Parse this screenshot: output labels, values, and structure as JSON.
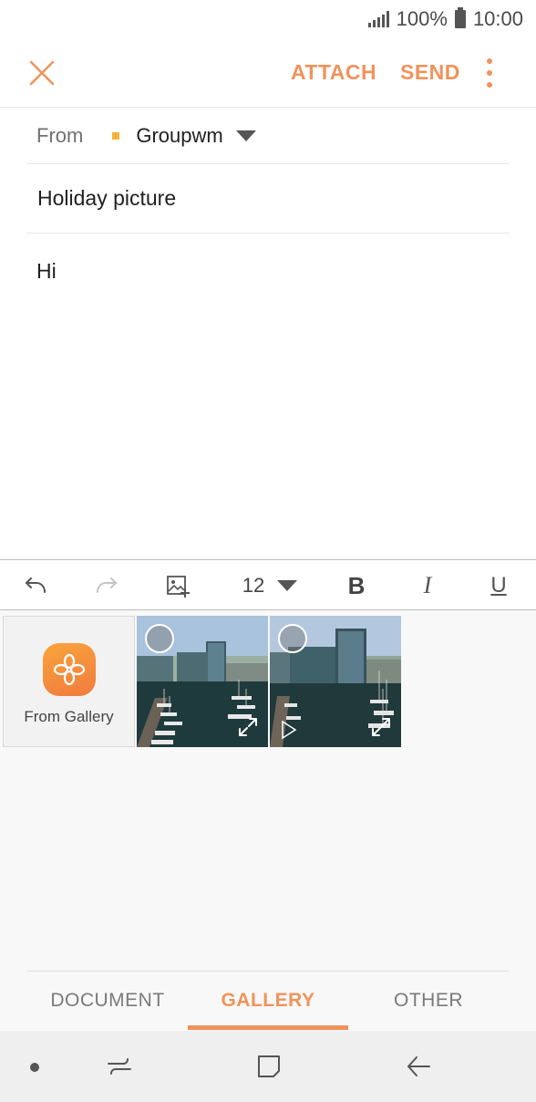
{
  "status_bar": {
    "battery_percent": "100%",
    "time": "10:00",
    "icons": [
      "signal-icon",
      "battery-icon"
    ]
  },
  "action_bar": {
    "close_icon": "close-icon",
    "attach_label": "ATTACH",
    "send_label": "SEND",
    "more_icon": "more-options-icon"
  },
  "compose": {
    "from_label": "From",
    "account_name": "Groupwm",
    "subject": "Holiday picture",
    "body": "Hi"
  },
  "format_toolbar": {
    "undo_icon": "undo-icon",
    "redo_icon": "redo-icon",
    "insert_image_icon": "insert-image-icon",
    "font_size": "12",
    "bold_label": "B",
    "italic_label": "I",
    "underline_label": "U"
  },
  "attachment_panel": {
    "gallery_tile_label": "From Gallery",
    "photos": [
      {
        "name": "photo-1",
        "selected": false
      },
      {
        "name": "photo-2",
        "selected": false
      }
    ],
    "tabs": [
      {
        "label": "DOCUMENT",
        "active": false
      },
      {
        "label": "GALLERY",
        "active": true
      },
      {
        "label": "OTHER",
        "active": false
      }
    ]
  },
  "nav_bar": {
    "icons": [
      "dot-icon",
      "recent-apps-icon",
      "home-icon",
      "back-icon"
    ]
  },
  "colors": {
    "accent": "#f0935b",
    "account_dot": "#f4b33d",
    "gallery_icon_top": "#f9a43b",
    "gallery_icon_bottom": "#f17b3f"
  }
}
